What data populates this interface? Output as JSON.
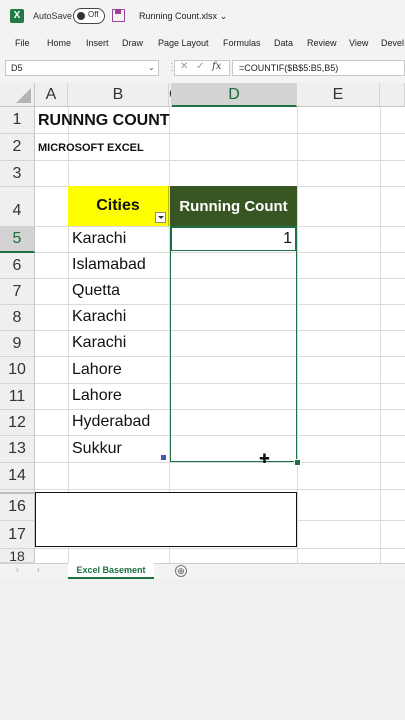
{
  "titlebar": {
    "autosave_label": "AutoSave",
    "autosave_state": "Off",
    "file_name": "Running Count.xlsx",
    "chevron": "⌄"
  },
  "ribbon": {
    "tabs": [
      "File",
      "Home",
      "Insert",
      "Draw",
      "Page Layout",
      "Formulas",
      "Data",
      "Review",
      "View",
      "Devel"
    ]
  },
  "formula_bar": {
    "name_box": "D5",
    "formula": "=COUNTIF($B$5:B5,B5)"
  },
  "grid": {
    "columns": [
      "A",
      "B",
      "C",
      "D",
      "E"
    ],
    "rows": [
      "1",
      "2",
      "3",
      "4",
      "5",
      "6",
      "7",
      "8",
      "9",
      "10",
      "11",
      "12",
      "13",
      "14",
      "16",
      "17",
      "18"
    ],
    "selected_cell": "D5"
  },
  "cells": {
    "title": "RUNNNG COUNT",
    "subtitle": "MICROSOFT EXCEL",
    "cities_header": "Cities",
    "running_count_header": "Running Count",
    "cities": [
      "Karachi",
      "Islamabad",
      "Quetta",
      "Karachi",
      "Karachi",
      "Lahore",
      "Lahore",
      "Hyderabad",
      "Sukkur"
    ],
    "d5_value": "1"
  },
  "colors": {
    "excel_green": "#1e7145",
    "header_yellow": "#ffff00",
    "header_dark_green": "#375623"
  },
  "sheet_tabs": {
    "active": "Excel Basement",
    "add_icon": "⊕"
  }
}
